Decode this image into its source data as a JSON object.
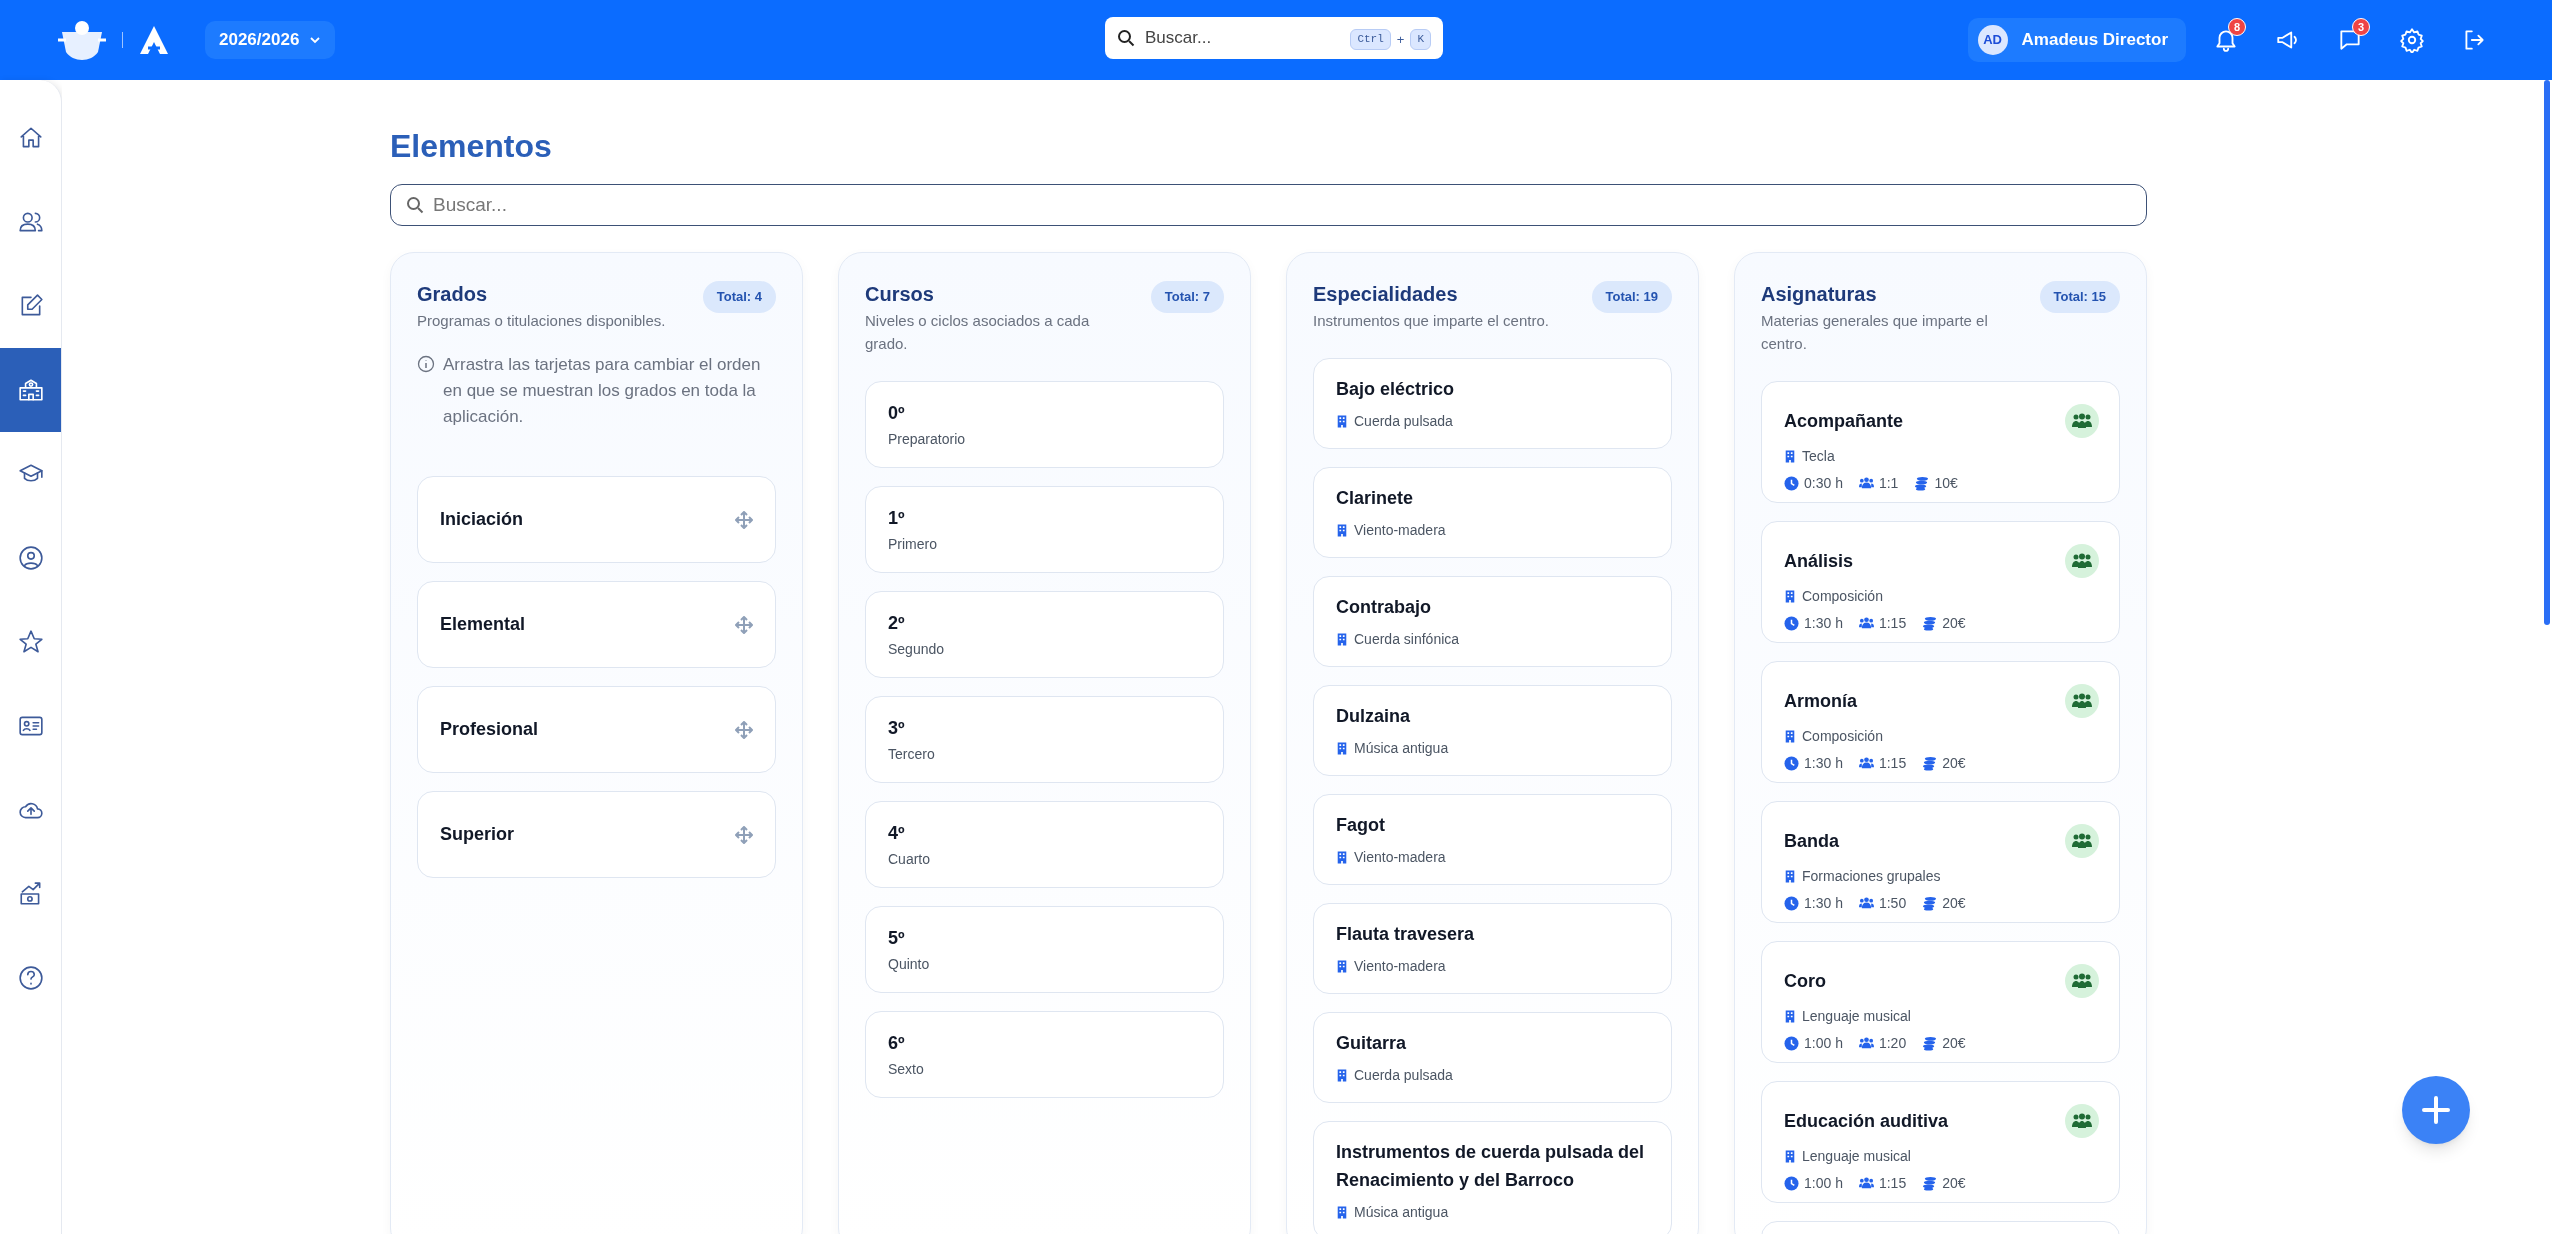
{
  "topbar": {
    "year": "2026/2026",
    "search_placeholder": "Buscar...",
    "shortcut": [
      "Ctrl",
      "+",
      "K"
    ],
    "user_initials": "AD",
    "user_name": "Amadeus Director",
    "notifications_badge": "8",
    "messages_badge": "3"
  },
  "sidebar": {
    "items": [
      {
        "selected": false
      },
      {
        "selected": false
      },
      {
        "selected": false
      },
      {
        "selected": true
      },
      {
        "selected": false
      },
      {
        "selected": false
      },
      {
        "selected": false
      },
      {
        "selected": false
      },
      {
        "selected": false
      },
      {
        "selected": false
      },
      {
        "selected": false
      }
    ]
  },
  "page": {
    "title": "Elementos",
    "search_placeholder": "Buscar..."
  },
  "columns": [
    {
      "title": "Grados",
      "total": "Total: 4",
      "description": "Programas o titulaciones disponibles.",
      "info": "Arrastra las tarjetas para cambiar el orden en que se muestran los grados en toda la aplicación.",
      "items": [
        {
          "kind": "draggable",
          "name": "Iniciación"
        },
        {
          "kind": "draggable",
          "name": "Elemental"
        },
        {
          "kind": "draggable",
          "name": "Profesional"
        },
        {
          "kind": "draggable",
          "name": "Superior"
        }
      ]
    },
    {
      "title": "Cursos",
      "total": "Total: 7",
      "description": "Niveles o ciclos asociados a cada grado.",
      "items": [
        {
          "kind": "course",
          "name": "0º",
          "subtitle": "Preparatorio"
        },
        {
          "kind": "course",
          "name": "1º",
          "subtitle": "Primero"
        },
        {
          "kind": "course",
          "name": "2º",
          "subtitle": "Segundo"
        },
        {
          "kind": "course",
          "name": "3º",
          "subtitle": "Tercero"
        },
        {
          "kind": "course",
          "name": "4º",
          "subtitle": "Cuarto"
        },
        {
          "kind": "course",
          "name": "5º",
          "subtitle": "Quinto"
        },
        {
          "kind": "course",
          "name": "6º",
          "subtitle": "Sexto"
        }
      ]
    },
    {
      "title": "Especialidades",
      "total": "Total: 19",
      "description": "Instrumentos que imparte el centro.",
      "items": [
        {
          "kind": "specialty",
          "name": "Bajo eléctrico",
          "department": "Cuerda pulsada"
        },
        {
          "kind": "specialty",
          "name": "Clarinete",
          "department": "Viento-madera"
        },
        {
          "kind": "specialty",
          "name": "Contrabajo",
          "department": "Cuerda sinfónica"
        },
        {
          "kind": "specialty",
          "name": "Dulzaina",
          "department": "Música antigua"
        },
        {
          "kind": "specialty",
          "name": "Fagot",
          "department": "Viento-madera"
        },
        {
          "kind": "specialty",
          "name": "Flauta travesera",
          "department": "Viento-madera"
        },
        {
          "kind": "specialty",
          "name": "Guitarra",
          "department": "Cuerda pulsada"
        },
        {
          "kind": "specialty",
          "name": "Instrumentos de cuerda pulsada del Renacimiento y del Barroco",
          "department": "Música antigua"
        }
      ]
    },
    {
      "title": "Asignaturas",
      "total": "Total: 15",
      "description": "Materias generales que imparte el centro.",
      "items": [
        {
          "kind": "subject",
          "name": "Acompañante",
          "department": "Tecla",
          "duration": "0:30 h",
          "ratio": "1:1",
          "price": "10€"
        },
        {
          "kind": "subject",
          "name": "Análisis",
          "department": "Composición",
          "duration": "1:30 h",
          "ratio": "1:15",
          "price": "20€"
        },
        {
          "kind": "subject",
          "name": "Armonía",
          "department": "Composición",
          "duration": "1:30 h",
          "ratio": "1:15",
          "price": "20€"
        },
        {
          "kind": "subject",
          "name": "Banda",
          "department": "Formaciones grupales",
          "duration": "1:30 h",
          "ratio": "1:50",
          "price": "20€"
        },
        {
          "kind": "subject",
          "name": "Coro",
          "department": "Lenguaje musical",
          "duration": "1:00 h",
          "ratio": "1:20",
          "price": "20€"
        },
        {
          "kind": "subject",
          "name": "Educación auditiva",
          "department": "Lenguaje musical",
          "duration": "1:00 h",
          "ratio": "1:15",
          "price": "20€"
        },
        {
          "kind": "subject_cut"
        }
      ]
    }
  ]
}
